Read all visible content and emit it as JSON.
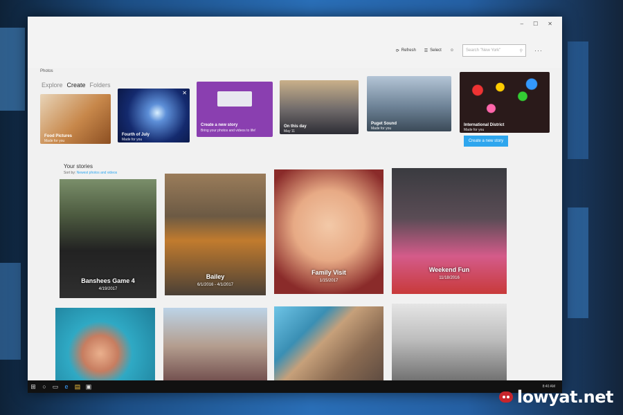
{
  "app": {
    "title": "Photos"
  },
  "window": {
    "minimize": "–",
    "maximize": "☐",
    "close": "✕"
  },
  "tabs": [
    {
      "label": "Explore"
    },
    {
      "label": "Create"
    },
    {
      "label": "Folders"
    }
  ],
  "commands": {
    "refresh": {
      "icon": "refresh-icon",
      "label": "Refresh"
    },
    "select": {
      "icon": "select-icon",
      "label": "Select"
    },
    "account": {
      "icon": "person-icon"
    },
    "search_placeholder": "Search \"New York\"",
    "more": "···"
  },
  "suggestions": [
    {
      "label": "Food Pictures",
      "sub": "Made for you"
    },
    {
      "label": "Fourth of July",
      "sub": "Made for you"
    },
    {
      "label": "Create a new story",
      "sub": "Bring your photos and videos to life!"
    },
    {
      "label": "On this day",
      "sub": "May 11"
    },
    {
      "label": "Puget Sound",
      "sub": "Made for you"
    },
    {
      "label": "International District",
      "sub": "Made for you"
    }
  ],
  "create_button": "Create a new story",
  "stories": {
    "title": "Your stories",
    "sort_prefix": "Sort by:",
    "sort_value": "Newest photos and videos",
    "items": [
      {
        "title": "Banshees Game 4",
        "date": "4/19/2017"
      },
      {
        "title": "Bailey",
        "date": "6/1/2016 - 4/1/2017"
      },
      {
        "title": "Family Visit",
        "date": "1/15/2017"
      },
      {
        "title": "Weekend Fun",
        "date": "11/18/2016"
      },
      {
        "title": "",
        "date": ""
      },
      {
        "title": "",
        "date": ""
      },
      {
        "title": "",
        "date": ""
      },
      {
        "title": "",
        "date": ""
      }
    ]
  },
  "taskbar": {
    "time": "8:40 AM"
  },
  "watermark": {
    "text": "lowyat.net"
  }
}
